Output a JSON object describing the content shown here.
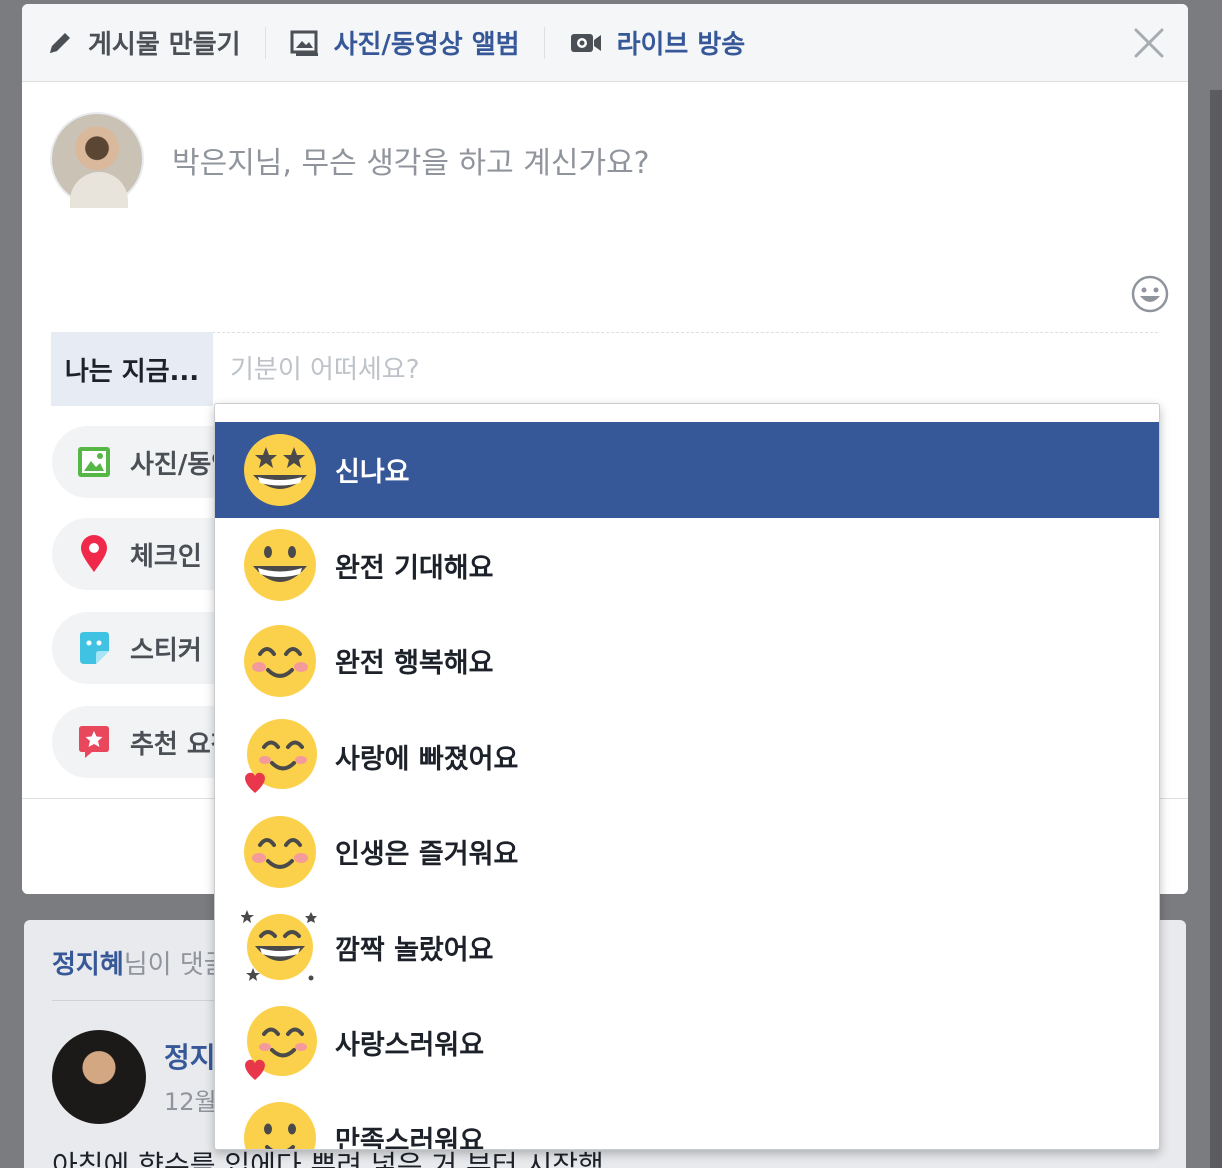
{
  "composer": {
    "tabs": [
      {
        "label": "게시물 만들기",
        "icon": "pencil-icon"
      },
      {
        "label": "사진/동영상 앨범",
        "icon": "photo-album-icon"
      },
      {
        "label": "라이브 방송",
        "icon": "video-camera-icon"
      }
    ],
    "post_placeholder": "박은지님, 무슨 생각을 하고 계신가요?",
    "feeling_label": "나는 지금...",
    "feeling_placeholder": "기분이 어떠세요?",
    "actions": [
      {
        "label": "사진/동영상",
        "icon": "photo-icon",
        "color": "#56b646"
      },
      {
        "label": "체크인",
        "icon": "location-pin-icon",
        "color": "#f0284a"
      },
      {
        "label": "스티커",
        "icon": "sticker-icon",
        "color": "#40c3e2"
      },
      {
        "label": "추천 요청",
        "icon": "recommendation-icon",
        "color": "#e9475b"
      }
    ]
  },
  "feelings": [
    {
      "label": "신나요",
      "emoji": "star-eyes-emoji"
    },
    {
      "label": "완전 기대해요",
      "emoji": "big-grin-emoji"
    },
    {
      "label": "완전 행복해요",
      "emoji": "happy-blush-emoji"
    },
    {
      "label": "사랑에 빠졌어요",
      "emoji": "in-love-emoji"
    },
    {
      "label": "인생은 즐거워요",
      "emoji": "happy-blush-emoji"
    },
    {
      "label": "깜짝 놀랐어요",
      "emoji": "sparkle-grin-emoji"
    },
    {
      "label": "사랑스러워요",
      "emoji": "in-love-emoji"
    },
    {
      "label": "만족스러워요",
      "emoji": "content-emoji"
    }
  ],
  "selected_feeling": "신나요",
  "story": {
    "header_name": "정지혜",
    "header_suffix": "님이 댓글",
    "author_name": "정지",
    "time": "12월",
    "text": "아침에 향수를 입에다 뿌려 넣은 거 부터 시작했"
  },
  "colors": {
    "accent": "#365899",
    "post_button": "#4267b2"
  }
}
